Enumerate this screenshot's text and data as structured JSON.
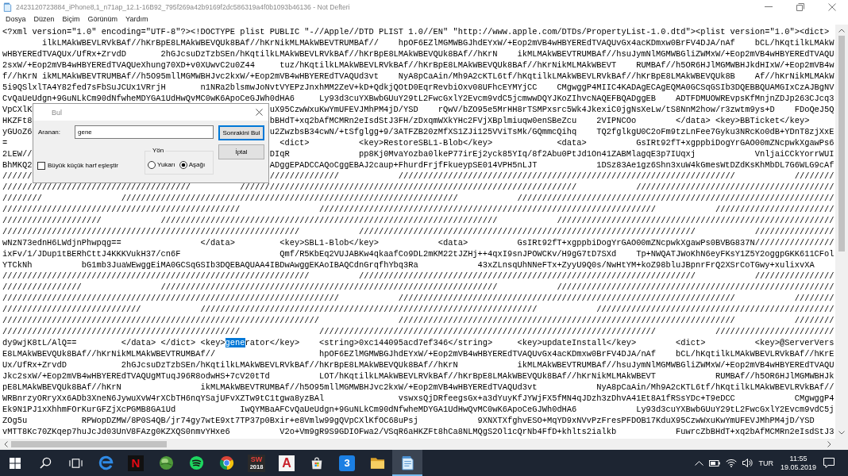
{
  "window": {
    "title": "2423120723884_iPhone8,1_n71ap_12.1-16B92_795f269a42b9169f2dc586319a4f0b1093b46136 - Not Defteri"
  },
  "menu": [
    "Dosya",
    "Düzen",
    "Biçim",
    "Görünüm",
    "Yardım"
  ],
  "editor": {
    "lines": [
      {
        "text": "<?xml version=\"1.0\" encoding=\"UTF-8\"?><!DOCTYPE plist PUBLIC \"-//Apple//DTD PLIST 1.0//EN\" \"http://www.apple.com/DTDs/PropertyList-1.0.dtd\"><plist version=\"1.0\"><dict>"
      },
      {
        "text": "\tilkLMAkWBEVLRVkBAf//hKrBpE8LMAkWBEVQUk8BAf//hKrNikMLMAkWBEVTRUMBAf//\thpOF6EZlMGMWBGJhdEYxW/+Eop2mVB4wHBYEREdTVAQUvGx4acKDmxw0BrFV4DJA/nAf\tbCL/hKqtilkLMAkW"
      },
      {
        "text": "wHBYEREdTVAQUx/UfRx+ZrvdD\t2hGJcsuDzTzbSEn/hKqtilkLMAkWBEVLRVkBAf//hKrBpE8LMAkWBEVQUk8BAf//hKrN\tikMLMAkWBEVTRUMBAf//hsuJymNlMGMWBGliZWMxW/+Eop2mVB4wHBYEREdTVAQU"
      },
      {
        "text": "2sxW/+Eop2mVB4wHBYEREdTVAQUeXhung70XD+v0XUwvC2u0Z44\ttuz/hKqtilkLMAkWBEVLRVkBAf//hKrBpE8LMAkWBEVQUk8BAf//hKrNikMLMAkWBEVT\tRUMBAf//h5OR6HJlMGMWBHJkdHIxW/+Eop2mVB4w"
      },
      {
        "text": "f//hKrN\tikMLMAkWBEVTRUMBAf//h5O95mllMGMWBHJvc2kxW/+Eop2mVB4wHBYEREdTVAQUd3vt\tNyA8pCaAin/Mh9A2cKTL6tf/hKqtilkLMAkWBEVLRVkBAf//hKrBpE8LMAkWBEVQUk8B\tAf//hKrNikMLMAkW"
      },
      {
        "text": "5i9QSlxlTA4Y82fed7sFbSuJCUx1VRrjH\tn1NRa2blsmwJoNvtVYEPzJnxhMM2ZeV+kD+QdkjQOtD0EqrRevbiOxv08UFhcEYMYjCC\tCMgwggP4MIIC4KADAgECAgEQMA0GCSqGSIb3DQEBBQUAMGIxCzAJBgNV"
      },
      {
        "text": "CvQaUeUdgn+9GuNLkCm90dNfwheMDYGA1UdHwQvMC0wK6ApoCeGJWh0dHA6\tLy93d3cuYXBwbGUuY29tL2FwcGxlY2Evcm9vdC5jcmwwDQYJKoZIhvcNAQEFBQADggEB\tADTFDMUOWREvpsKfMnjnZDJp263CJcq3"
      },
      {
        "left": "VpCXlK",
        "right": "uX95CzwWxuKwYmUFEVJMhPM4jD/YSD\trQwV/bZO95e5MrHH8rTSMPxsrc5Wk4JkexiC0jgNsXeLw/tS8NnM2how/r3zwtm9ys+D\tFDoQeJ5Q"
      },
      {
        "left": "HKZFt8",
        "right": "bBHdT+xq2bAfMCMRn2eIsdStJ3FH/zDxqmWXkYHc2FVjXBplmiuqw0enSBeZcu\t2VIPNCOo\t</data>\t<key>BBTicket</key>"
      },
      {
        "left": "yGUoZ6",
        "right": "u2ZwzbsB34cwN/+tSfglgg+9/3ATFZB20zMfXS1ZJi125VViTsMk/GQmmcQihq\tTQ2fglkgU0C2oFm9tzLnFee7Gyku3NRcKo0dB+YDnT8zjXxE"
      },
      {
        "left": "=",
        "right": "  <dict>\t\t<key>RestoreSBL1-Blob</key>\t\t<data>\t\tGsIRt92fT+xgppbiDogYrGAO00mZNcpwkXgawPs6"
      },
      {
        "left": "2LEW//",
        "right": "DIqR\t\tpp8Kj0MvaYozba0lkeP77irEj2yck85YIq/8f2Abu0PtJd1On41ZABMlagqE3p7IUqxj\t\tVnljaiCCkYorrWUI"
      },
      {
        "left": "BhMKQ2",
        "right": "ADggEPADCCAQoCggEBAJ2caup+FhurdFrjfFkueypSE014VPH5nLJT\t\t1DSz83Ae1gz6Shn3xuW4kGmesWtDZdKsKhMbDL7G6WLG9cAf"
      },
      {
        "left": "//////",
        "right": "//////////////\t\t////////////////////////////////////////////////////////////////////\t\t////////"
      },
      {
        "text": "//////////////////////////////////////\t\t////////////////////////////////////////////////////////////////////\t\t////////////////////////////////////////"
      },
      {
        "text": "////////\t\t////////////////////////////////////////////////////////////////////\t\t////////////////////////////////////////////////////////////////"
      },
      {
        "text": "////////////////////////////////////////////////\t\t////////////////////////////////////////////////////////////////////\t\t////////////////////////"
      },
      {
        "text": "////////////////////\t\t////////////////////////////////////////////////////////////////////\t\t////////////////////////////////////////////////////////"
      },
      {
        "text": "////////////////////////////////////////////////////////////\t\t////////////////////////////////////////////////////////////////////\t\t////////////////"
      },
      {
        "text": "wNzN73ednH6LWdjnPhwpqg==\t\t</data>\t\t<key>SBL1-Blob</key>\t\t<data>\t\tGsIRt92fT+xgppbiDogYrGAO00mZNcpwkXgawPs0BVBG837N////////////////"
      },
      {
        "text": "ixFv/1/JDup1tBERhCttJ4KKKVukH37/cn6F\t\t\tQmf/R5KbEq2VUJABKw4qkaafCo9DL2mKM22tJZHj++4qxI9snJPOWCKv/H9gG7tD7SXd\tTp+NWQATJWoKhN6eyFKsY1Z5Y2oggpGKK611CFol"
      },
      {
        "text": "YTCkNh\t\tbG1mb3JuaWEwggEiMA0GCSqGSIb3DQEBAQUAA4IBDwAwggEKAoIBAQCdnGrqfhYbq3Ra\t\t43xZLnsqUhNNeFTx+ZyyU9Q0s/NwHtYM+koZ98bluJBpnrFrQ2XSrCoTGwy+xulixvXA"
      },
      {
        "text": "//////////////////////////////////////////////////////////////\t\t////////////////////////////////////////////////////////////////////\t\t////////////////"
      },
      {
        "text": "////////////////\t\t////////////////////////////////////////////////////////////////////\t\t////////////////////////////////////////////////////////"
      },
      {
        "text": "////////////////////////////////////////////////////////////////////\t\t////////////////////////////////////////////////////////////////////\t\t////////"
      },
      {
        "text": "////////////////////////////\t\t////////////////////////////////////////////////////////////////////\t\t////////////////////////////////////////////////"
      },
      {
        "text": "////////////////////////////////////////////////////////////////\t\t////////////////////////////////////////////////////////////////////\t\t////////"
      },
      {
        "text": "////////////////////////////////////////////////\t\t////////////////////////////////////////////////////////////////////\t\t////////////////////////"
      },
      {
        "parts": [
          {
            "text": "dy9wjK8tL/AlQ==\t\t</data>\t</dict>\t<key>",
            "selected": false
          },
          {
            "text": "gene",
            "selected": true
          },
          {
            "text": "rator</key>\t<string>0xc144095acd7ef346</string>\t<key>updateInstall</key>\t<dict>\t\t<key>@ServerVers",
            "selected": false
          }
        ]
      },
      {
        "text": "E8LMAkWBEVQUk8BAf//hKrNikMLMAkWBEVTRUMBAf//\t\t\thpOF6EZlMGMWBGJhdEYxW/+Eop2mVB4wHBYEREdTVAQUvGx4acKDmxw0BrFV4DJA/nAf\tbCL/hKqtilkLMAkWBEVLRVkBAf//hKrE"
      },
      {
        "text": "Ux/UfRx+ZrvdD\t\t2hGJcsuDzTzbSEn/hKqtilkLMAkWBEVLRVkBAf//hKrBpE8LMAkWBEVQUk8BAf//hKrN\t\tikMLMAkWBEVTRUMBAf//hsuJymNlMGMWBGliZWMxW/+Eop2mVB4wHBYEREdTVAQU"
      },
      {
        "text": "Jkc2sxW/+Eop2mVB4wHBYEREdTVAQUgMTuqJ96R8odwHS+7cV20tTd\t\tLOT/hKqtilkLMAkWBEVLRVkBAf//hKrBpE8LMAkWBEVQUk8BAf//hKrNikMLMAkWBEVT\t\tRUMBAf//h5OR6HJlMGMWBHJk"
      },
      {
        "text": "pE8LMAkWBEVQUk8BAf//hKrN\t\tikMLMAkWBEVTRUMBAf//h5O95mllMGMWBHJvc2kxW/+Eop2mVB4wHBYEREdTVAQUd3vt\t\tNyA8pCaAin/Mh9A2cKTL6tf/hKqtilkLMAkWBEVLRVkBAf//"
      },
      {
        "text": "WRBnrzyORryXx6ADb3XneN6JywuXvW4rXCbTH6nqYSajUFvXZTw9tC1tgwa8yzBAl\t\tvswxsQjDRfeegsGx+a3dYuyKfJYWjFX5fMN4qJDzh3zDhvA41Et8A1fRSsYDc+T9eDCC\t\tCMgwggP4"
      },
      {
        "text": "Ek9N1PJ1xXhhmFOrKurGFZjXcPGMB8GA1Ud\t\tIwQYMBaAFCvQaUeUdgn+9GuNLkCm90dNfwheMDYGA1UdHwQvMC0wK6ApoCeGJWh0dHA6\t\tLy93d3cuYXBwbGUuY29tL2FwcGxlY2Evcm9vdC5j"
      },
      {
        "text": "ZOg5u\t\tRPWopDZMW/8P0S4QB/jr74gy7wtE9xt7TP37p0Bxir+e8Vmlw99gQVpCXlKfOC68uPsj\t\t9XNXTXfghvESO+MqYD9xNVvPzFresPFDOB17KduX95CzwWxuKwYmUFEVJMhPM4jD/YSD"
      },
      {
        "text": "vMTT8Kc70ZKqep7huJcJd03UnV8FAzg0KZXQS0nmvYHxe6\t\tV2o+Vm9gR9S9GDIOFwa2/VSqR6aHKZFt8hCa8NLMQgS2Ol1cQrNb4FfD+khlts2ialkb\t\tFuwrcZbBHdT+xq2bAfMCMRn2eIsdStJ3"
      }
    ]
  },
  "find_dialog": {
    "title": "Bul",
    "search_label": "Aranan:",
    "search_value": "gene",
    "buttons": [
      {
        "label": "Sonrakini Bul",
        "focused": true
      },
      {
        "label": "İptal",
        "focused": false
      }
    ],
    "direction": {
      "label": "Yön",
      "options": [
        {
          "label": "Yukarı",
          "selected": false
        },
        {
          "label": "Aşağı",
          "selected": true
        }
      ]
    },
    "match_case": {
      "label": "Büyük küçük harf eşleştir",
      "checked": false
    }
  },
  "taskbar": {
    "apps": [
      {
        "kind": "start",
        "selected": false
      },
      {
        "kind": "search",
        "selected": false
      },
      {
        "kind": "taskview",
        "selected": false
      },
      {
        "kind": "ring",
        "selected": false
      },
      {
        "kind": "ntile",
        "glyph": "N",
        "selected": false
      },
      {
        "kind": "globe",
        "selected": false
      },
      {
        "kind": "waves",
        "selected": false
      },
      {
        "kind": "wheel",
        "selected": false
      },
      {
        "kind": "swtile",
        "glyph": "SW",
        "sub": "2018",
        "selected": false
      },
      {
        "kind": "atile",
        "glyph": "A",
        "selected": false
      },
      {
        "kind": "bag",
        "selected": false
      },
      {
        "kind": "ctile",
        "glyph": "3",
        "selected": false
      },
      {
        "kind": "folder",
        "selected": false
      },
      {
        "kind": "pad",
        "selected": true
      }
    ],
    "language": "TUR",
    "time": "11:55",
    "date": "19.05.2019"
  }
}
